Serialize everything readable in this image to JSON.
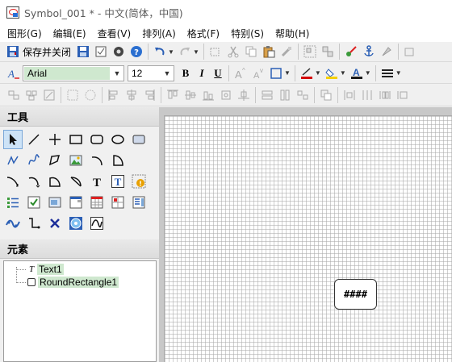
{
  "window": {
    "title": "Symbol_001 * - 中文(简体，中国)"
  },
  "menu": [
    {
      "label": "图形(G)"
    },
    {
      "label": "编辑(E)"
    },
    {
      "label": "查看(V)"
    },
    {
      "label": "排列(A)"
    },
    {
      "label": "格式(F)"
    },
    {
      "label": "特别(S)"
    },
    {
      "label": "帮助(H)"
    }
  ],
  "toolbar": {
    "save_close_label": "保存并关闭"
  },
  "format_toolbar": {
    "font_name": "Arial",
    "font_size": "12",
    "bold": "B",
    "italic": "I",
    "underline": "U"
  },
  "tools_panel": {
    "title": "工具",
    "icons": [
      "pointer-icon",
      "line-icon",
      "cross-icon",
      "rectangle-icon",
      "rounded-rectangle-icon",
      "ellipse-icon",
      "button-rect-icon",
      "polyline-icon",
      "freehand-icon",
      "polygon-icon",
      "image-icon",
      "arc-icon",
      "pie-icon",
      "spline-icon",
      "curve-icon",
      "closed-curve-icon",
      "chord-icon",
      "text-icon",
      "textbox-icon",
      "warning-icon",
      "list-icon",
      "checkbox-icon",
      "combobox-icon",
      "panel-icon",
      "table-icon",
      "grid-icon",
      "form-icon",
      "wave-icon",
      "connector-icon",
      "delete-icon",
      "globe-icon",
      "trend-icon"
    ]
  },
  "elements_panel": {
    "title": "元素",
    "items": [
      {
        "label": "Text1",
        "type_icon": "text-node-icon"
      },
      {
        "label": "RoundRectangle1",
        "type_icon": "round-rect-node-icon"
      }
    ]
  },
  "canvas": {
    "shape_text": "####"
  },
  "colors": {
    "accent_selection": "#cfe8cf",
    "active_tool": "#cde3f7",
    "line_color_bar": "#d40000",
    "fill_color_bar": "#f5d000",
    "font_color_bar": "#1a1a1a"
  }
}
